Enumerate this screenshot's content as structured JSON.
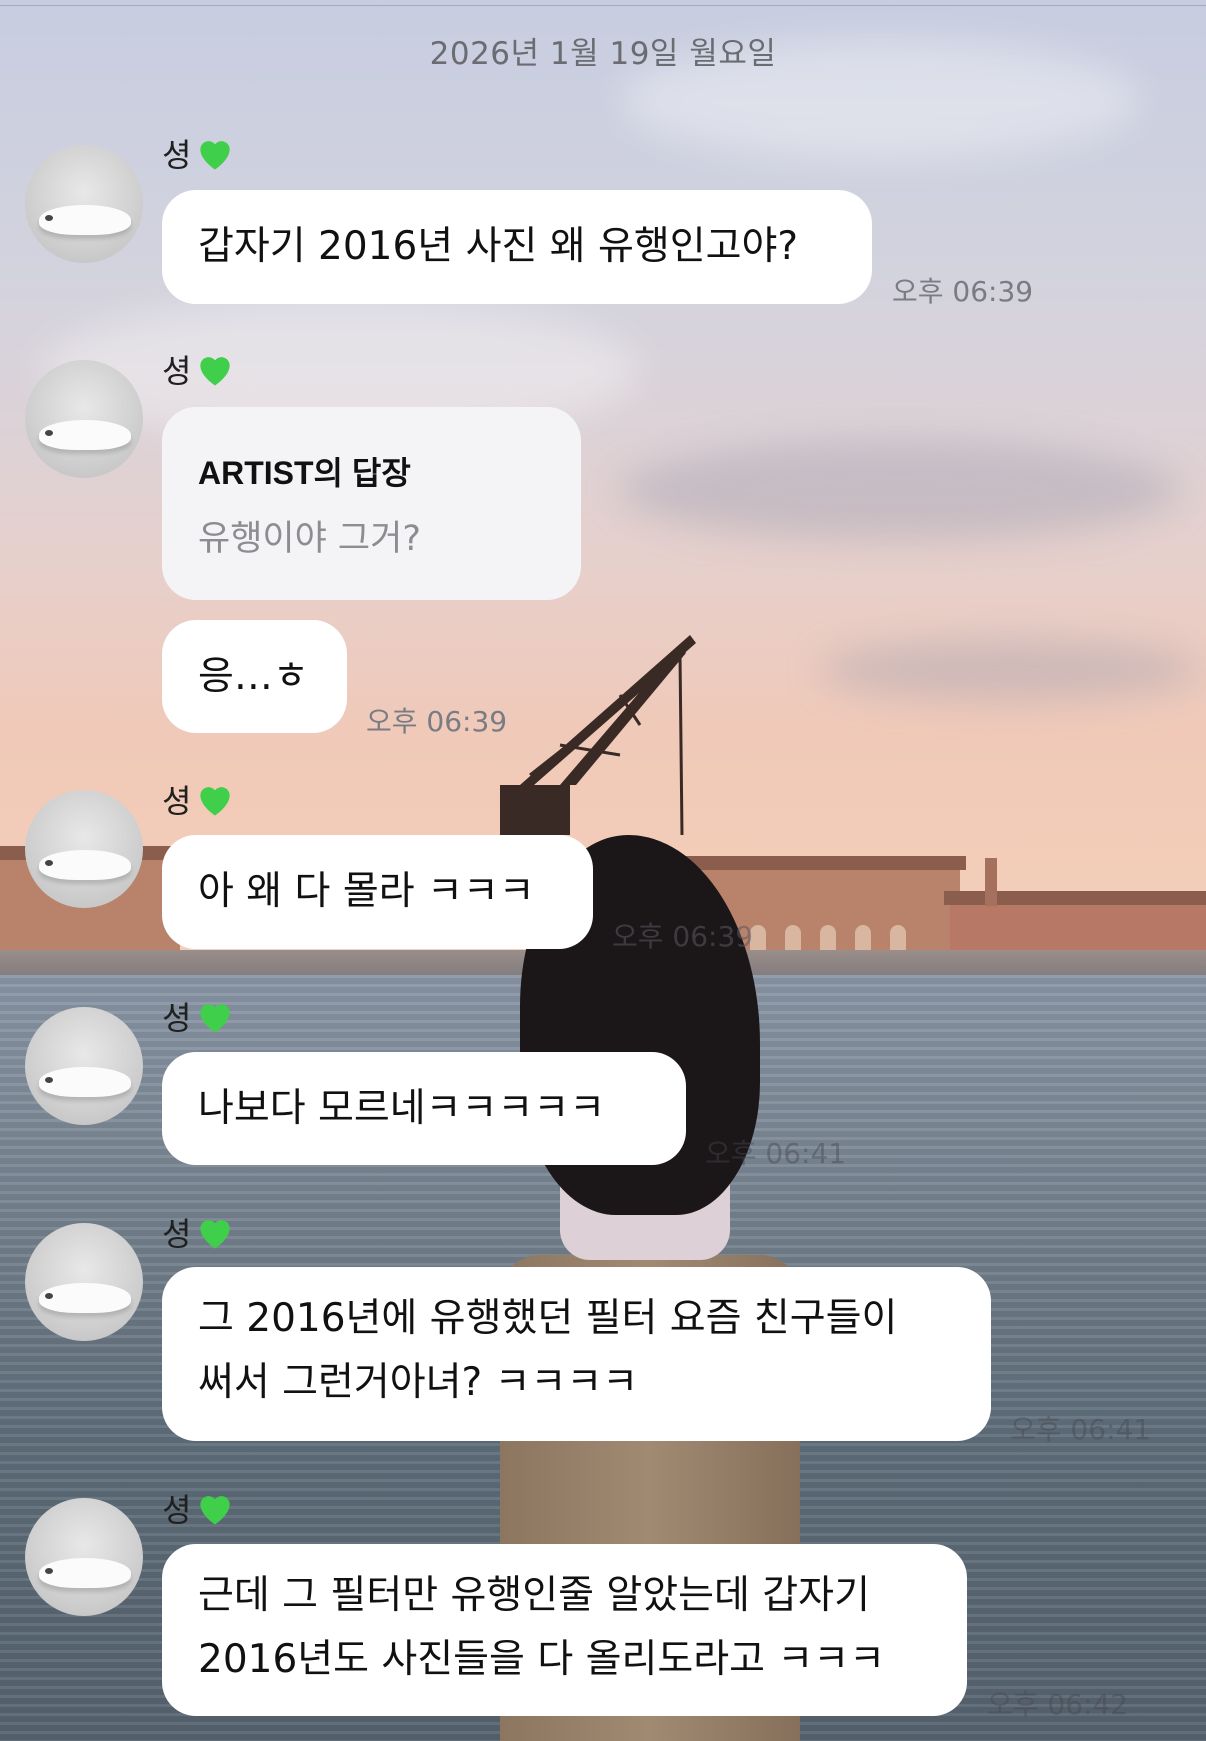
{
  "chat": {
    "date": "2026년 1월 19일 월요일",
    "sender_name": "셩",
    "messages": [
      {
        "text": "갑자기 2016년 사진 왜 유행인고야?",
        "time": "오후 06:39"
      },
      {
        "reply_title": "ARTIST의 답장",
        "reply_quote": "유행이야 그거?"
      },
      {
        "text": "응…ㅎ",
        "time": "오후 06:39"
      },
      {
        "text": "아 왜 다 몰라 ㅋㅋㅋ",
        "time": "오후 06:39"
      },
      {
        "text": "나보다 모르네ㅋㅋㅋㅋㅋ",
        "time": "오후 06:41"
      },
      {
        "text_line1": "그 2016년에 유행했던 필터 요즘 친구들이",
        "text_line2": "써서 그런거아녀? ㅋㅋㅋㅋ",
        "time": "오후 06:41"
      },
      {
        "text_line1": "근데 그 필터만 유행인줄 알았는데 갑자기",
        "text_line2": "2016년도 사진들을 다 올리도라고 ㅋㅋㅋ",
        "time": "오후 06:42"
      }
    ]
  },
  "icons": {
    "heart": "green-heart-icon",
    "avatar": "dog-avatar"
  },
  "colors": {
    "bubble": "#ffffff",
    "reply_bubble": "#f4f4f6",
    "heart": "#3fcf4b",
    "time": "#7a7c84"
  }
}
